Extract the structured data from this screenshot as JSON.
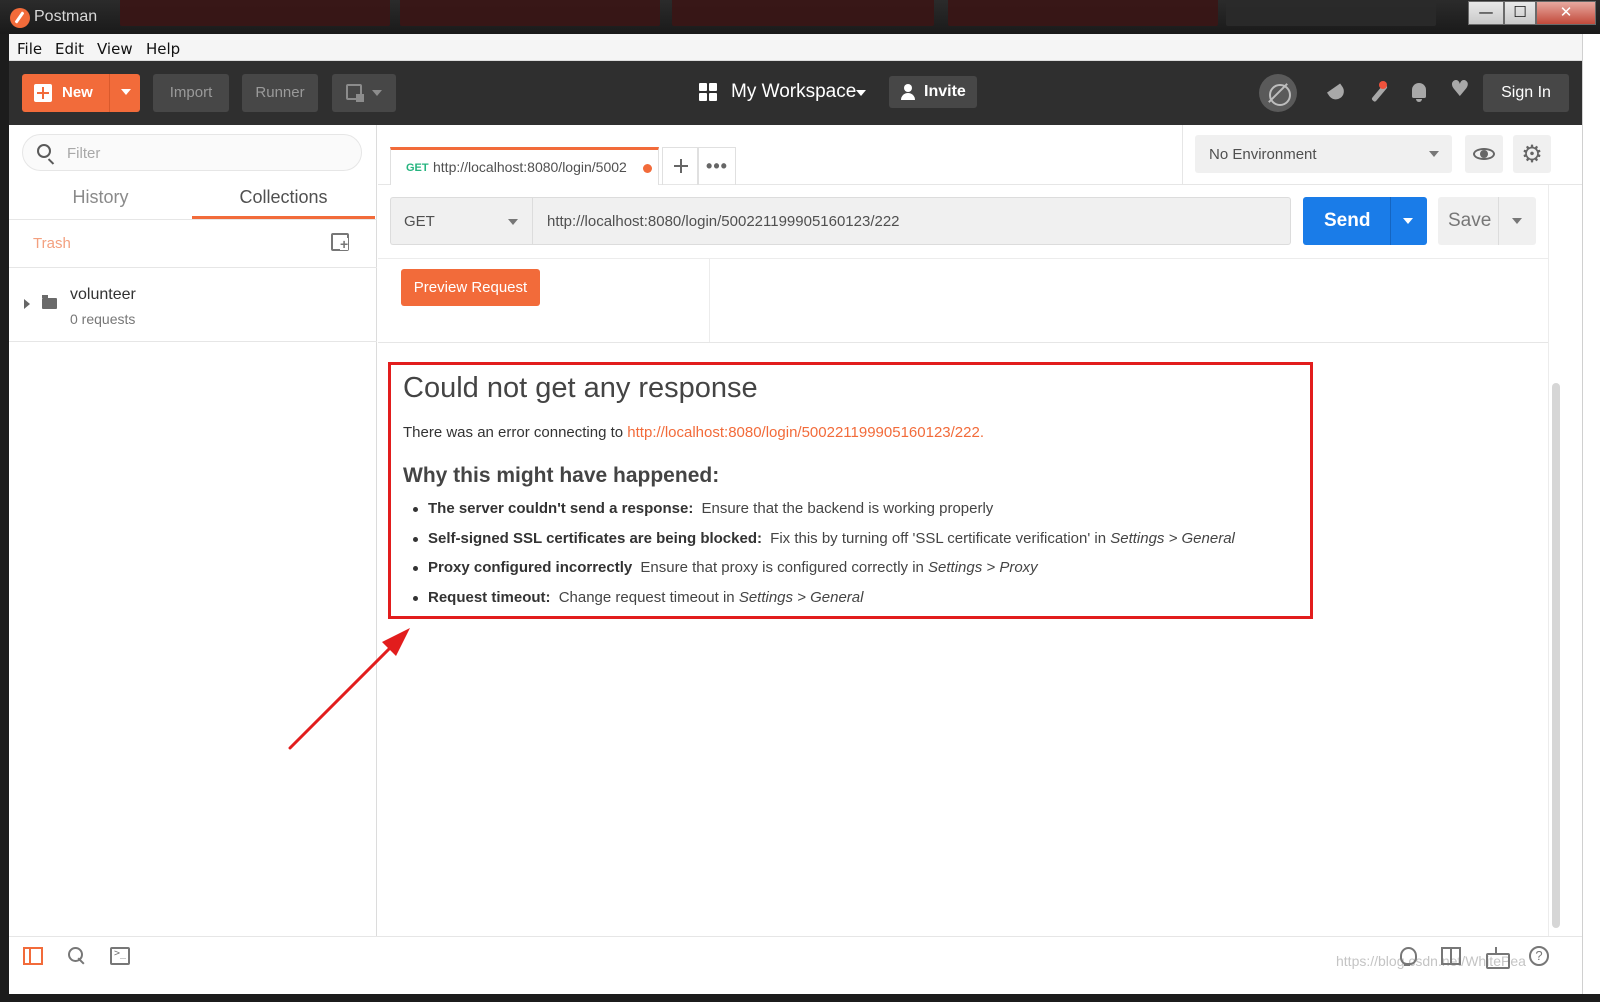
{
  "window": {
    "title": "Postman",
    "minimize_glyph": "—",
    "maximize_glyph": "☐",
    "close_glyph": "✕"
  },
  "menu": {
    "items": [
      "File",
      "Edit",
      "View",
      "Help"
    ]
  },
  "header": {
    "new_label": "New",
    "import_label": "Import",
    "runner_label": "Runner",
    "workspace_label": "My Workspace",
    "invite_label": "Invite",
    "signin_label": "Sign In",
    "heart_glyph": "♥"
  },
  "sidebar": {
    "filter_placeholder": "Filter",
    "tabs": {
      "history": "History",
      "collections": "Collections"
    },
    "trash_label": "Trash",
    "collections": [
      {
        "name": "volunteer",
        "count": "0 requests"
      }
    ]
  },
  "request_tab": {
    "method": "GET",
    "url": "http://localhost:8080/login/5002",
    "more_glyph": "•••"
  },
  "environment": {
    "selected": "No Environment",
    "gear_glyph": "⚙"
  },
  "request": {
    "method": "GET",
    "url": "http://localhost:8080/login/500221199905160123/222",
    "send_label": "Send",
    "save_label": "Save",
    "preview_label": "Preview Request"
  },
  "error": {
    "title": "Could not get any response",
    "intro": "There was an error connecting to",
    "url": "http://localhost:8080/login/500221199905160123/222.",
    "why_heading": "Why this might have happened:",
    "reasons": [
      {
        "bold": "The server couldn't send a response:",
        "text": "Ensure that the backend is working properly",
        "path": ""
      },
      {
        "bold": "Self-signed SSL certificates are being blocked:",
        "text": "Fix this by turning off 'SSL certificate verification' in",
        "path": "Settings > General"
      },
      {
        "bold": "Proxy configured incorrectly",
        "text": "Ensure that proxy is configured correctly in",
        "path": "Settings > Proxy"
      },
      {
        "bold": "Request timeout:",
        "text": "Change request timeout in",
        "path": "Settings > General"
      }
    ]
  },
  "footer": {
    "help_glyph": "?",
    "watermark": "https://blog.csdn.net/WhitePea"
  },
  "colors": {
    "accent": "#f26b3a",
    "send": "#1a7ce8",
    "annotation": "#e21d1d"
  }
}
